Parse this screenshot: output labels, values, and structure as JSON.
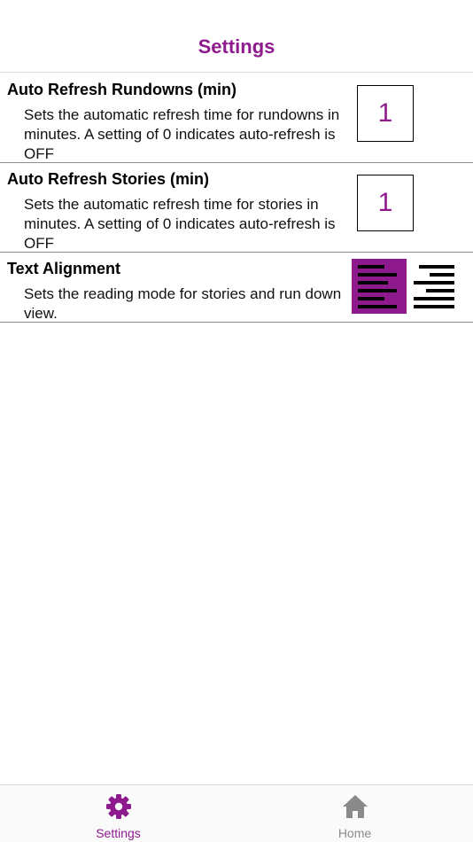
{
  "header": {
    "title": "Settings"
  },
  "settings": {
    "rundowns": {
      "title": "Auto Refresh Rundowns (min)",
      "description": "Sets the automatic refresh time for rundowns in minutes. A setting of 0 indicates auto-refresh is OFF",
      "value": "1"
    },
    "stories": {
      "title": "Auto Refresh Stories (min)",
      "description": "Sets the automatic refresh time for stories in minutes. A setting of 0 indicates auto-refresh is OFF",
      "value": "1"
    },
    "alignment": {
      "title": "Text Alignment",
      "description": "Sets the reading mode for stories and run down view.",
      "selected_icon": "align-left-icon",
      "other_icon": "align-right-icon"
    }
  },
  "tabs": [
    {
      "label": "Settings",
      "icon": "gear-icon",
      "active": true
    },
    {
      "label": "Home",
      "icon": "home-icon",
      "active": false
    }
  ],
  "colors": {
    "accent": "#8e1a8e",
    "inactive": "#8a8a8a"
  }
}
